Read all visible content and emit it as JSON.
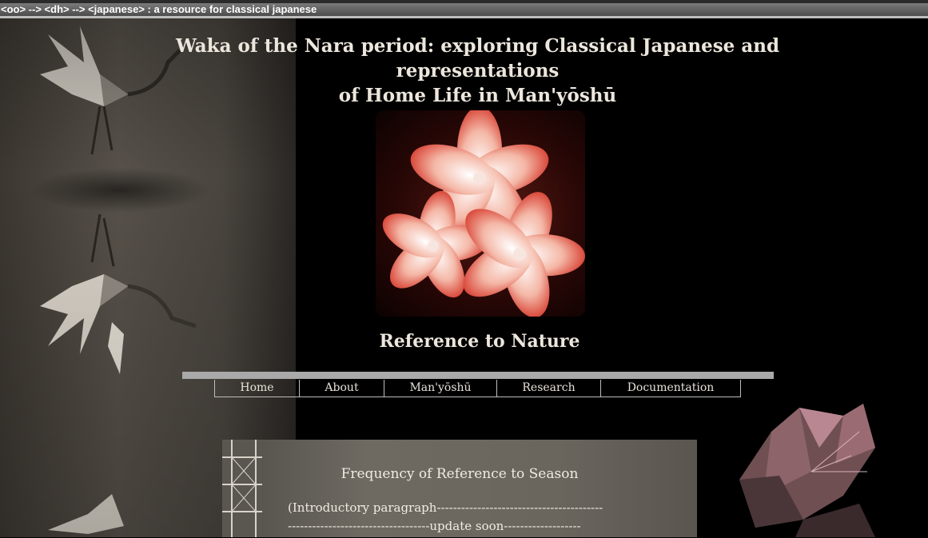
{
  "topbar": {
    "text": "<oo> --> <dh> --> <japanese> : a resource for classical japanese"
  },
  "header": {
    "title_line1": "Waka of the Nara period: exploring Classical Japanese and representations",
    "title_line2": "of Home Life in Man'yōshū"
  },
  "section_heading": "Reference to Nature",
  "nav": {
    "items": [
      {
        "label": "Home"
      },
      {
        "label": "About"
      },
      {
        "label": "Man'yōshū"
      },
      {
        "label": "Research"
      },
      {
        "label": "Documentation"
      }
    ]
  },
  "content": {
    "heading": "Frequency of Reference to Season",
    "line1": "(Introductory paragraph-----------------------------------------",
    "line2": "-----------------------------------update soon-------------------"
  },
  "colors": {
    "background": "#000000",
    "text": "#ece6dc",
    "nav_bar": "#a9a9a9"
  }
}
